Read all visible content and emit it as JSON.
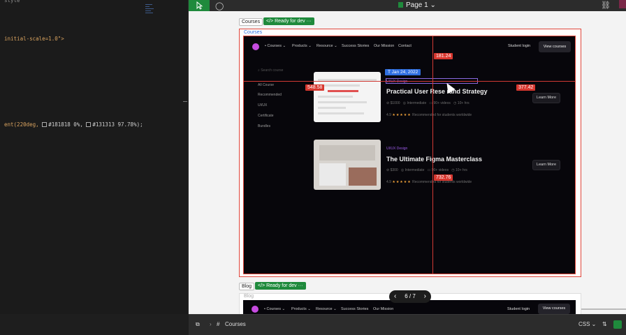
{
  "code": {
    "top_line": "style",
    "viewport_line": "initial-scale=1.0\">",
    "gradient_line_pre": "ent(220deg, ",
    "gradient_color1": "#181818 0%,",
    "gradient_color2": "#131313 97.78%);"
  },
  "toolbar": {
    "page_label": "Page 1"
  },
  "frames": {
    "courses": {
      "tag": "Courses",
      "status": "Ready for dev",
      "name": "Courses"
    },
    "blog": {
      "tag": "Blog",
      "status": "Ready for dev",
      "name": "Blog"
    }
  },
  "site": {
    "nav": {
      "items": [
        "Courses",
        "Products",
        "Resource",
        "Success Stories",
        "Our Mission",
        "Contact"
      ],
      "login": "Student login",
      "cta": "View courses"
    },
    "sidebar": {
      "search_placeholder": "Search course",
      "items": [
        "All Course",
        "Recommended",
        "UI/UX",
        "Certificate",
        "Bundles"
      ]
    },
    "courses": [
      {
        "date_badge": "Jan 24, 2022",
        "category": "UI/UX Design",
        "title": "Practical User Rese   rand Strategy",
        "price": "$1000",
        "level": "Intermediate",
        "videos": "90+ videos",
        "hours": "10+ hrs",
        "rating": "4.9",
        "rating_note": "Recommended for students worldwide",
        "cta": "Learn More"
      },
      {
        "category": "UI/UX Design",
        "title": "The Ultimate Figma Masterclass",
        "price": "$300",
        "level": "Intermediate",
        "videos": "90+ videos",
        "hours": "10+ hrs",
        "rating": "4.9",
        "rating_note": "Recommended for students worldwide",
        "cta": "Learn More"
      }
    ]
  },
  "measurements": {
    "top": "181.24",
    "left": "548.58",
    "right": "377.42",
    "bottom": "732.76"
  },
  "pager": {
    "label": "6 / 7"
  },
  "bottombar": {
    "breadcrumb": "Courses",
    "language": "CSS"
  },
  "colors": {
    "accent_green": "#1f8a3c",
    "measure_red": "#d8372f",
    "selection_blue": "#2f6fe0",
    "site_bg": "#07060b"
  }
}
